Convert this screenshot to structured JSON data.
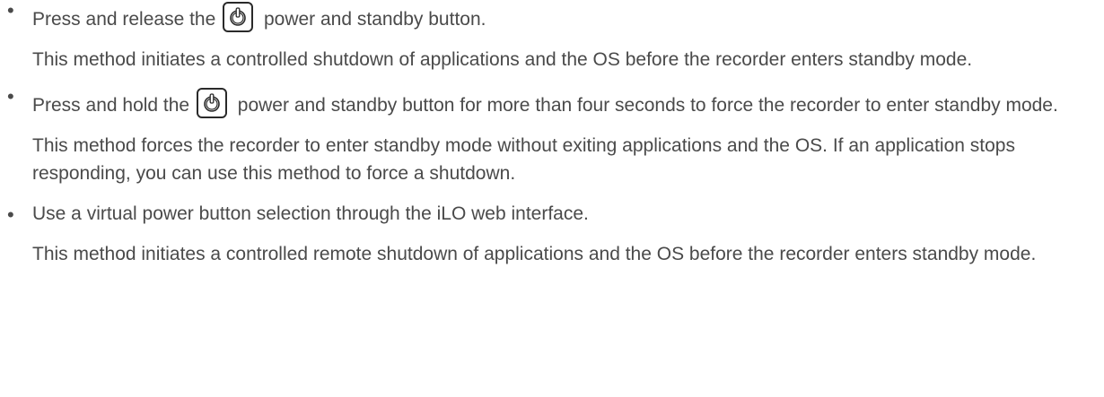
{
  "bullets": [
    {
      "prefix": "Press and release the",
      "icon": "power-standby-icon",
      "suffix": "power and standby button.",
      "description": "This method initiates a controlled shutdown of applications and the OS before the recorder enters standby mode."
    },
    {
      "prefix": "Press and hold the",
      "icon": "power-standby-icon",
      "suffix": "power and standby button for more than four seconds to force the recorder to enter standby mode.",
      "description": "This method forces the recorder to enter standby mode without exiting applications and the OS. If an application stops responding, you can use this method to force a shutdown."
    },
    {
      "text": "Use a virtual power button selection through the iLO web interface.",
      "description": "This method initiates a controlled remote shutdown of applications and the OS before the recorder enters standby mode."
    }
  ],
  "bullet_glyph": "•",
  "colors": {
    "text": "#4a4a4a",
    "icon_border": "#2a2a2a"
  }
}
